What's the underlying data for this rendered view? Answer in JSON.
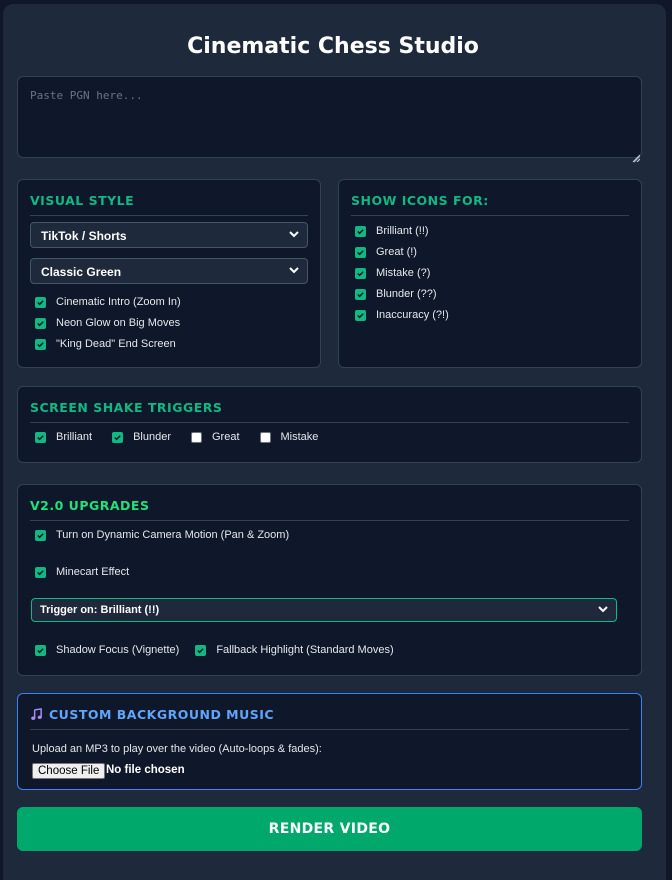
{
  "app": {
    "title": "Cinematic Chess Studio"
  },
  "pgn": {
    "placeholder": "Paste PGN here...",
    "value": ""
  },
  "visual_style": {
    "title": "VISUAL STYLE",
    "format_select": "TikTok / Shorts",
    "theme_select": "Classic Green",
    "options": [
      {
        "label": "Cinematic Intro (Zoom In)",
        "checked": true
      },
      {
        "label": "Neon Glow on Big Moves",
        "checked": true
      },
      {
        "label": "\"King Dead\" End Screen",
        "checked": true
      }
    ]
  },
  "show_icons": {
    "title": "SHOW ICONS FOR:",
    "options": [
      {
        "label": "Brilliant (!!)",
        "checked": true
      },
      {
        "label": "Great (!)",
        "checked": true
      },
      {
        "label": "Mistake (?)",
        "checked": true
      },
      {
        "label": "Blunder (??)",
        "checked": true
      },
      {
        "label": "Inaccuracy (?!)",
        "checked": true
      }
    ]
  },
  "shake": {
    "title": "SCREEN SHAKE TRIGGERS",
    "options": [
      {
        "label": "Brilliant",
        "checked": true
      },
      {
        "label": "Blunder",
        "checked": true
      },
      {
        "label": "Great",
        "checked": false
      },
      {
        "label": "Mistake",
        "checked": false
      }
    ]
  },
  "upgrades": {
    "title": "V2.0 UPGRADES",
    "camera": {
      "label": "Turn on Dynamic Camera Motion (Pan & Zoom)",
      "checked": true
    },
    "minecart": {
      "label": "Minecart Effect",
      "checked": true
    },
    "trigger_select": "Trigger on: Brilliant (!!)",
    "shadow": {
      "label": "Shadow Focus (Vignette)",
      "checked": true
    },
    "fallback": {
      "label": "Fallback Highlight (Standard Moves)",
      "checked": true
    }
  },
  "music": {
    "title": "CUSTOM BACKGROUND MUSIC",
    "icon": "music-note-icon",
    "description": "Upload an MP3 to play over the video (Auto-loops & fades):",
    "choose_label": "Choose File",
    "file_status": "No file chosen"
  },
  "render": {
    "label": "RENDER VIDEO"
  },
  "colors": {
    "accent": "#10b981",
    "button": "#00a86b",
    "music_accent": "#60a5fa"
  }
}
